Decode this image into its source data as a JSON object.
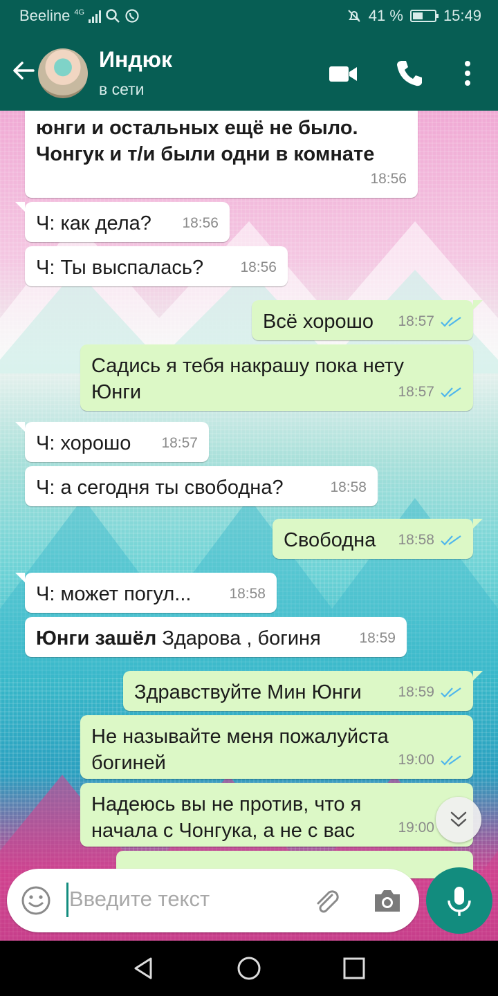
{
  "status_bar": {
    "carrier": "Beeline",
    "network": "4G",
    "battery": "41 %",
    "battery_level": 0.41,
    "time": "15:49"
  },
  "header": {
    "contact_name": "Индюк",
    "status": "в сети",
    "icons": [
      "back-arrow-icon",
      "video-call-icon",
      "phone-icon",
      "more-options-icon"
    ]
  },
  "messages": [
    {
      "dir": "in",
      "text": "юнги и остальных ещё не было. Чонгук и  т/и были одни в комнате",
      "time": "18:56"
    },
    {
      "dir": "in",
      "text": "Ч: как дела?",
      "time": "18:56"
    },
    {
      "dir": "in",
      "text": "Ч: Ты выспалась?",
      "time": "18:56"
    },
    {
      "dir": "out",
      "text": "Всё хорошо",
      "time": "18:57"
    },
    {
      "dir": "out",
      "text": "Садись я тебя накрашу пока нету Юнги",
      "time": "18:57"
    },
    {
      "dir": "in",
      "text": "Ч: хорошо",
      "time": "18:57"
    },
    {
      "dir": "in",
      "text": "Ч: а сегодня ты свободна?",
      "time": "18:58"
    },
    {
      "dir": "out",
      "text": "Свободна",
      "time": "18:58"
    },
    {
      "dir": "in",
      "text": "Ч: может погул...",
      "time": "18:58"
    },
    {
      "dir": "in",
      "bold": "Юнги зашёл",
      "text": " Здарова , богиня",
      "time": "18:59"
    },
    {
      "dir": "out",
      "text": "Здравствуйте Мин Юнги",
      "time": "18:59"
    },
    {
      "dir": "out",
      "text": "Не называйте меня пожалуйста богиней",
      "time": "19:00"
    },
    {
      "dir": "out",
      "text": "Надеюсь вы не против, что я начала с Чонгука, а не с вас",
      "time": "19:00"
    }
  ],
  "input": {
    "placeholder": "Введите текст"
  },
  "colors": {
    "header": "#075e54",
    "outgoing_bubble": "#dcf8c6",
    "incoming_bubble": "#ffffff",
    "accent": "#128c7e",
    "read_ticks": "#4fb6ec"
  }
}
